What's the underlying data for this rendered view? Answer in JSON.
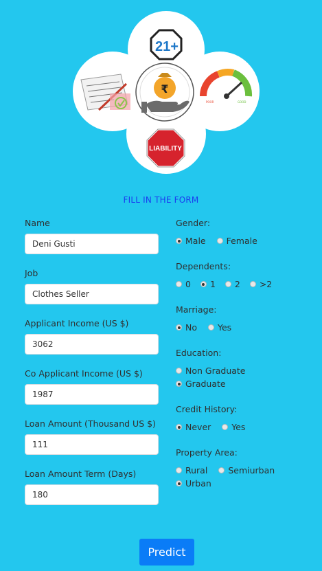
{
  "hero": {
    "age_badge": "21+",
    "rupee_symbol": "₹",
    "gauge_poor": "POOR",
    "gauge_good": "GOOD",
    "liability_sign": "LIABILITY",
    "colors": {
      "cloud": "#ffffff",
      "stop_red": "#d6232d",
      "money_bag": "#f3a52a"
    }
  },
  "form": {
    "title": "FILL IN THE FORM",
    "name": {
      "label": "Name",
      "value": "Deni Gusti"
    },
    "job": {
      "label": "Job",
      "value": "Clothes Seller"
    },
    "applicant_income": {
      "label": "Applicant Income (US $)",
      "value": "3062"
    },
    "co_applicant_income": {
      "label": "Co Applicant Income (US $)",
      "value": "1987"
    },
    "loan_amount": {
      "label": "Loan Amount (Thousand US $)",
      "value": "111"
    },
    "loan_term": {
      "label": "Loan Amount Term (Days)",
      "value": "180"
    },
    "gender": {
      "label": "Gender:",
      "options": [
        "Male",
        "Female"
      ],
      "selected": "Male"
    },
    "dependents": {
      "label": "Dependents:",
      "options": [
        "0",
        "1",
        "2",
        ">2"
      ],
      "selected": "1"
    },
    "marriage": {
      "label": "Marriage:",
      "options": [
        "No",
        "Yes"
      ],
      "selected": "No"
    },
    "education": {
      "label": "Education:",
      "options": [
        "Non Graduate",
        "Graduate"
      ],
      "selected": "Graduate"
    },
    "credit_history": {
      "label": "Credit History:",
      "options": [
        "Never",
        "Yes"
      ],
      "selected": "Never"
    },
    "property_area": {
      "label": "Property Area:",
      "options": [
        "Rural",
        "Semiurban",
        "Urban"
      ],
      "selected": "Urban"
    },
    "predict_label": "Predict"
  },
  "colors": {
    "background": "#23c7ee",
    "title": "#1a3cf0",
    "button": "#0a7cf7"
  }
}
